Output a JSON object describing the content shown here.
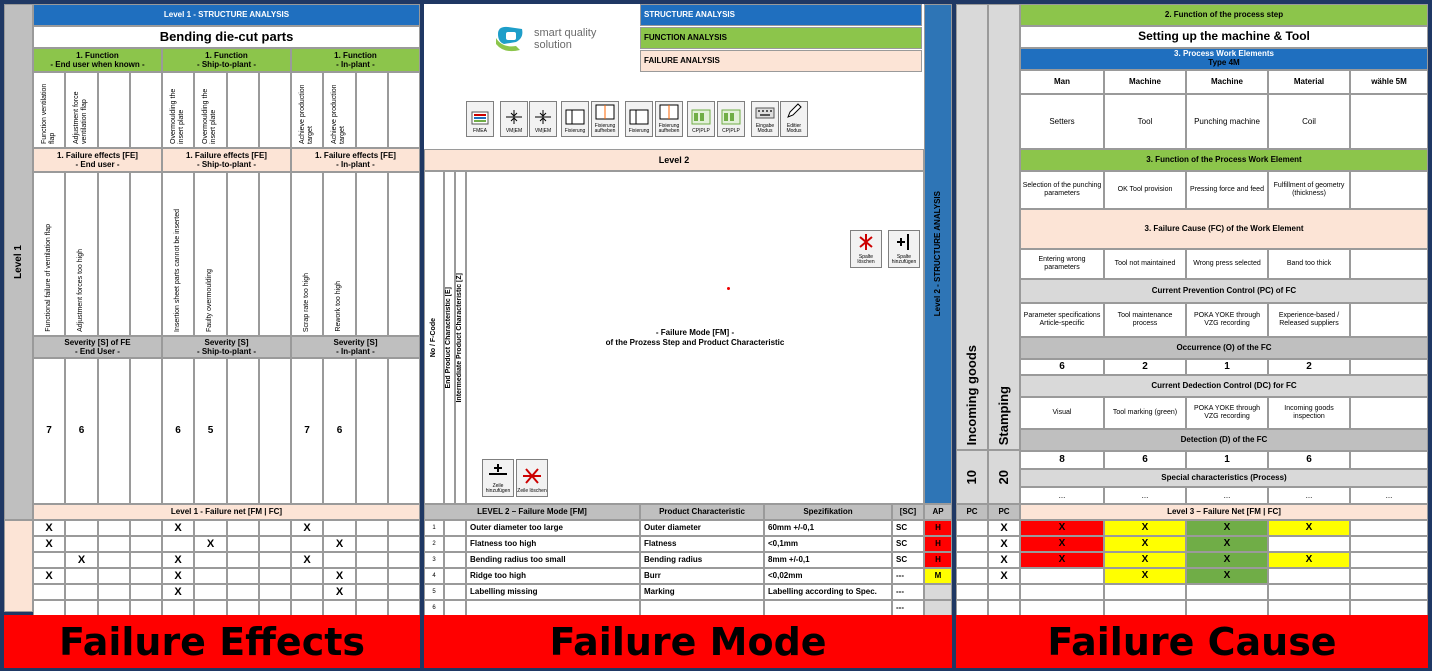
{
  "level1": {
    "header": "Level 1 - STRUCTURE ANALYSIS",
    "title": "Bending die-cut parts",
    "side_label": "Level 1",
    "functions": [
      {
        "title": "1. Function",
        "sub": "- End user when known -"
      },
      {
        "title": "1. Function",
        "sub": "- Ship-to-plant -"
      },
      {
        "title": "1. Function",
        "sub": "- In-plant -"
      }
    ],
    "function_items": [
      "Function ventilation flap",
      "Adjustment force ventilation flap",
      "",
      "",
      "Overmoulding the insert plate",
      "Overmoulding the insert plate",
      "",
      "",
      "Achieve production target",
      "Achieve production target",
      "",
      ""
    ],
    "failure_effects": [
      {
        "title": "1. Failure effects [FE]",
        "sub": "- End user -"
      },
      {
        "title": "1. Failure effects [FE]",
        "sub": "- Ship-to-plant -"
      },
      {
        "title": "1. Failure effects [FE]",
        "sub": "- In-plant -"
      }
    ],
    "effect_items": [
      "Functional failure of ventilation flap",
      "Adjustment forces too high",
      "",
      "",
      "Insertion sheet parts cannot be inserted",
      "Faulty overmoulding",
      "",
      "",
      "Scrap rate too high",
      "Rework too high",
      "",
      ""
    ],
    "severity": [
      {
        "title": "Severity [S] of FE",
        "sub": "- End User -"
      },
      {
        "title": "Severity [S]",
        "sub": "- Ship-to-plant -"
      },
      {
        "title": "Severity [S]",
        "sub": "- In-plant -"
      }
    ],
    "severity_values": [
      "7",
      "6",
      "",
      "",
      "6",
      "5",
      "",
      "",
      "7",
      "6",
      "",
      ""
    ],
    "failure_net_label": "Level 1 - Failure net [FM | FC]",
    "net_rows": [
      [
        "X",
        "",
        "",
        "",
        "X",
        "",
        "",
        "",
        "X",
        "",
        "",
        ""
      ],
      [
        "X",
        "",
        "",
        "",
        "",
        "X",
        "",
        "",
        "",
        "X",
        "",
        ""
      ],
      [
        "",
        "X",
        "",
        "",
        "X",
        "",
        "",
        "",
        "X",
        "",
        "",
        ""
      ],
      [
        "X",
        "",
        "",
        "",
        "X",
        "",
        "",
        "",
        "",
        "X",
        "",
        ""
      ],
      [
        "",
        "",
        "",
        "",
        "X",
        "",
        "",
        "",
        "",
        "X",
        "",
        ""
      ],
      [
        "",
        "",
        "",
        "",
        "",
        "",
        "",
        "",
        "",
        "",
        "",
        ""
      ]
    ]
  },
  "level2": {
    "logo_line1": "smart quality",
    "logo_line2": "solution",
    "tabs": [
      "STRUCTURE ANALYSIS",
      "FUNCTION ANALYSIS",
      "FAILURE ANALYSIS"
    ],
    "toolbar": [
      {
        "label": "FMEA",
        "icon": "fmea-icon"
      },
      {
        "label": "VM|EM",
        "icon": "vm-em-icon"
      },
      {
        "label": "VM|EM",
        "icon": "vm-em-icon-2"
      },
      {
        "label": "Fixierung",
        "icon": "fixierung-icon"
      },
      {
        "label": "Fixierung aufheben",
        "icon": "fixierung-aufheben-icon"
      },
      {
        "label": "Fixierung",
        "icon": "fixierung-icon-2"
      },
      {
        "label": "Fixierung aufheben",
        "icon": "fixierung-aufheben-icon-2"
      },
      {
        "label": "CP|PLP",
        "icon": "cp-plp-icon"
      },
      {
        "label": "CP|PLP",
        "icon": "cp-plp-icon-2"
      },
      {
        "label": "Eingabe Modus",
        "icon": "keyboard-icon"
      },
      {
        "label": "Editier Modus",
        "icon": "pencil-icon"
      }
    ],
    "level_label": "Level 2",
    "vert_no": "No / F-Code",
    "vert_end_product": "End Product Characteristic [E]",
    "vert_intermediate": "Intermediate Product Characteristic [Z]",
    "failure_mode_text1": "- Failure Mode [FM] -",
    "failure_mode_text2": "of the Prozess Step and Product Characteristic",
    "btn_spalte_loeschen": "Spalte löschen",
    "btn_spalte_hinzufuegen": "Spalte hinzufügen",
    "btn_zeile_hinzufuegen": "Zeile hinzufügen",
    "btn_zeile_loeschen": "Zeile löschen",
    "side_label": "Level 2 - STRUCTURE ANALYSIS",
    "table_headers": {
      "fm": "LEVEL 2 – Failure Mode [FM]",
      "pc": "Product Characteristic",
      "spec": "Spezifikation",
      "sc": "[SC]",
      "ap": "AP"
    },
    "rows": [
      {
        "no": "1",
        "fm": "Outer diameter too large",
        "pc": "Outer diameter",
        "spec": "60mm +/-0,1",
        "sc": "SC",
        "ap": "H"
      },
      {
        "no": "2",
        "fm": "Flatness too high",
        "pc": "Flatness",
        "spec": "<0,1mm",
        "sc": "SC",
        "ap": "H"
      },
      {
        "no": "3",
        "fm": "Bending radius too small",
        "pc": "Bending radius",
        "spec": "8mm +/-0,1",
        "sc": "SC",
        "ap": "H"
      },
      {
        "no": "4",
        "fm": "Ridge too high",
        "pc": "Burr",
        "spec": "<0,02mm",
        "sc": "---",
        "ap": "M"
      },
      {
        "no": "5",
        "fm": "Labelling missing",
        "pc": "Marking",
        "spec": "Labelling according to Spec.",
        "sc": "---",
        "ap": ""
      },
      {
        "no": "6",
        "fm": "",
        "pc": "",
        "spec": "",
        "sc": "---",
        "ap": ""
      }
    ]
  },
  "level3": {
    "col_incoming": "Incoming goods",
    "col_stamping": "Stamping",
    "num_incoming": "10",
    "num_stamping": "20",
    "pc_label": "PC",
    "function_header": "2. Function of the process step",
    "function_title": "Setting up the machine & Tool",
    "work_elements": "3. Process Work Elements",
    "type4m": "Type 4M",
    "types": [
      "Man",
      "Machine",
      "Machine",
      "Material",
      "wähle 5M"
    ],
    "elements": [
      "Setters",
      "Tool",
      "Punching machine",
      "Coil",
      ""
    ],
    "function_pwe_label": "3. Function of the Process Work Element",
    "function_pwe": [
      "Selection of the punching parameters",
      "OK Tool provision",
      "Pressing force and feed",
      "Fulfillment of geometry (thickness)",
      ""
    ],
    "failure_cause_label": "3. Failure Cause (FC) of the Work Element",
    "failure_causes": [
      "Entering wrong parameters",
      "Tool not maintained",
      "Wrong press selected",
      "Band too thick",
      ""
    ],
    "pc_control_label": "Current Prevention Control (PC) of FC",
    "pc_controls": [
      "Parameter specifications Article-specific",
      "Tool maintenance process",
      "POKA YOKE through VZG recording",
      "Experience-based / Released suppliers",
      ""
    ],
    "occurrence_label": "Occurrence (O) of the FC",
    "occurrence": [
      "6",
      "2",
      "1",
      "2",
      ""
    ],
    "dc_label": "Current Dedection Control (DC) for FC",
    "dc_controls": [
      "Visual",
      "Tool marking (green)",
      "POKA YOKE through VZG recording",
      "Incoming goods inspection",
      ""
    ],
    "detection_label": "Detection (D) of the FC",
    "detection": [
      "8",
      "6",
      "1",
      "6",
      ""
    ],
    "special_label": "Special characteristics (Process)",
    "special": [
      "...",
      "...",
      "...",
      "...",
      "..."
    ],
    "net_label": "Level 3 – Failure Net [FM | FC]",
    "pc_col": [
      "X",
      "X",
      "X",
      "X",
      "",
      ""
    ],
    "net_rows": [
      [
        "X",
        "X",
        "X",
        "X",
        ""
      ],
      [
        "X",
        "X",
        "X",
        "",
        ""
      ],
      [
        "X",
        "X",
        "X",
        "X",
        ""
      ],
      [
        "",
        "X",
        "X",
        "",
        ""
      ],
      [
        "",
        "",
        "",
        "",
        ""
      ],
      [
        "",
        "",
        "",
        "",
        ""
      ]
    ],
    "net_colors": [
      [
        "red",
        "yellow",
        "green",
        "yellow",
        ""
      ],
      [
        "red",
        "yellow",
        "green",
        "",
        ""
      ],
      [
        "red",
        "yellow",
        "green",
        "yellow",
        ""
      ],
      [
        "",
        "yellow",
        "green",
        "",
        ""
      ],
      [
        "",
        "",
        "",
        "",
        ""
      ],
      [
        "",
        "",
        "",
        "",
        ""
      ]
    ]
  },
  "banners": [
    "Failure Effects",
    "Failure Mode",
    "Failure Cause"
  ]
}
